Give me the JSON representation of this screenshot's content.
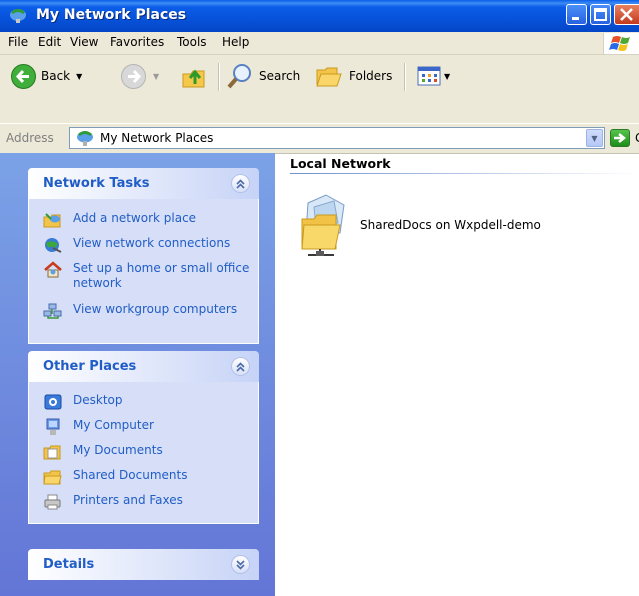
{
  "window": {
    "title": "My Network Places"
  },
  "menu": [
    "File",
    "Edit",
    "View",
    "Favorites",
    "Tools",
    "Help"
  ],
  "toolbar": {
    "back_label": "Back",
    "search_label": "Search",
    "folders_label": "Folders"
  },
  "address": {
    "label": "Address",
    "value": "My Network Places",
    "go_label": "Go"
  },
  "network_tasks": {
    "title": "Network Tasks",
    "items": [
      {
        "label": "Add a network place",
        "icon": "add-network-place-icon"
      },
      {
        "label": "View network connections",
        "icon": "network-connections-icon"
      },
      {
        "label": "Set up a home or small office network",
        "icon": "home-network-icon"
      },
      {
        "label": "View workgroup computers",
        "icon": "workgroup-computers-icon"
      }
    ]
  },
  "other_places": {
    "title": "Other Places",
    "items": [
      {
        "label": "Desktop",
        "icon": "desktop-icon"
      },
      {
        "label": "My Computer",
        "icon": "my-computer-icon"
      },
      {
        "label": "My Documents",
        "icon": "my-documents-icon"
      },
      {
        "label": "Shared Documents",
        "icon": "shared-folder-icon"
      },
      {
        "label": "Printers and Faxes",
        "icon": "printer-icon"
      }
    ]
  },
  "details": {
    "title": "Details"
  },
  "content": {
    "group_title": "Local Network",
    "items": [
      {
        "label": "SharedDocs on Wxpdell-demo",
        "icon": "network-share-icon"
      }
    ]
  },
  "colors": {
    "titlebar": "#0752d9",
    "taskpane": "#6f8ce0",
    "task_link": "#215dc6",
    "chrome": "#ece9d8"
  }
}
